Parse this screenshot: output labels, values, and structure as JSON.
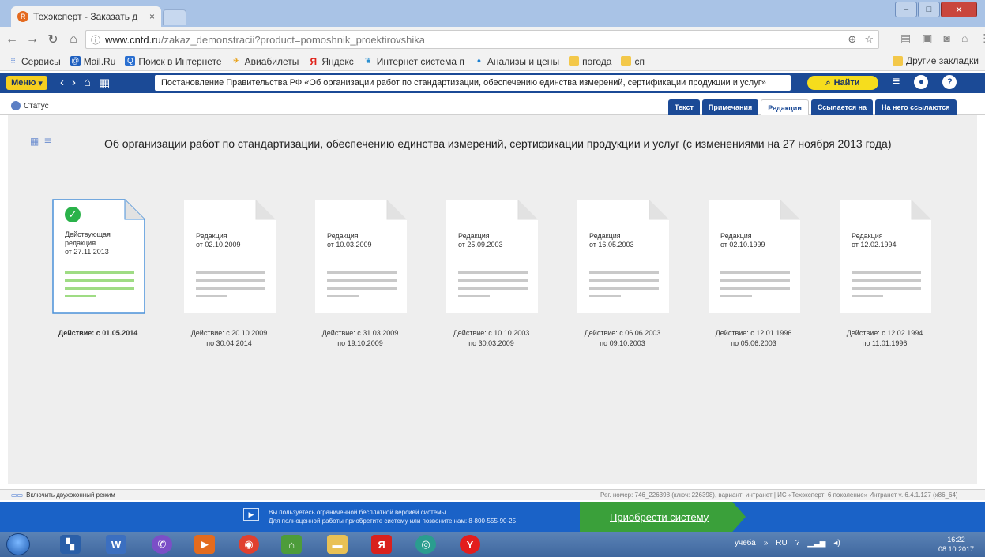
{
  "browser": {
    "tab_title": "Техэксперт - Заказать д",
    "tab_close": "×",
    "url_host": "www.cntd.ru",
    "url_path": "/zakaz_demonstracii?product=pomoshnik_proektirovshika",
    "bookmarks": [
      {
        "label": "Сервисы",
        "icon": "apps-grid-icon"
      },
      {
        "label": "Mail.Ru",
        "icon": "mailru-icon"
      },
      {
        "label": "Поиск в Интернете",
        "icon": "search-icon"
      },
      {
        "label": "Авиабилеты",
        "icon": "plane-icon"
      },
      {
        "label": "Яндекс",
        "icon": "yandex-icon"
      },
      {
        "label": "Интернет система п",
        "icon": "map-pin-icon"
      },
      {
        "label": "Анализы и цены",
        "icon": "drop-icon"
      },
      {
        "label": "погода",
        "icon": "folder-icon"
      },
      {
        "label": "сп",
        "icon": "folder-icon"
      }
    ],
    "other_bookmarks": "Другие закладки"
  },
  "app": {
    "menu_label": "Меню",
    "doc_title": "Постановление Правительства РФ «Об организации работ по стандартизации, обеспечению единства измерений, сертификации продукции и услуг»",
    "find_label": "Найти",
    "status_label": "Статус",
    "tabs": [
      {
        "label": "Текст",
        "active": false
      },
      {
        "label": "Примечания",
        "active": false
      },
      {
        "label": "Редакции",
        "active": true
      },
      {
        "label": "Ссылается на",
        "active": false
      },
      {
        "label": "На него ссылаются",
        "active": false
      }
    ]
  },
  "main": {
    "title": "Об организации работ по стандартизации, обеспечению единства измерений, сертификации продукции и услуг (с изменениями на 27 ноября 2013 года)",
    "editions": [
      {
        "label_lines": [
          "Действующая",
          "редакция",
          "от 27.11.2013"
        ],
        "caption1": "Действие: с 01.05.2014",
        "caption2": "",
        "active": true
      },
      {
        "label_lines": [
          "Редакция",
          "от 02.10.2009"
        ],
        "caption1": "Действие: с 20.10.2009",
        "caption2": "по 30.04.2014",
        "active": false
      },
      {
        "label_lines": [
          "Редакция",
          "от 10.03.2009"
        ],
        "caption1": "Действие: с 31.03.2009",
        "caption2": "по 19.10.2009",
        "active": false
      },
      {
        "label_lines": [
          "Редакция",
          "от 25.09.2003"
        ],
        "caption1": "Действие: с 10.10.2003",
        "caption2": "по 30.03.2009",
        "active": false
      },
      {
        "label_lines": [
          "Редакция",
          "от 16.05.2003"
        ],
        "caption1": "Действие: с 06.06.2003",
        "caption2": "по 09.10.2003",
        "active": false
      },
      {
        "label_lines": [
          "Редакция",
          "от 02.10.1999"
        ],
        "caption1": "Действие: с 12.01.1996",
        "caption2": "по 05.06.2003",
        "active": false
      },
      {
        "label_lines": [
          "Редакция",
          "от 12.02.1994"
        ],
        "caption1": "Действие: с 12.02.1994",
        "caption2": "по 11.01.1996",
        "active": false
      }
    ]
  },
  "footer": {
    "dual_mode": "Включить двухоконный режим",
    "reg_info": "Рег. номер: 746_226398 (ключ: 226398), вариант: интранет  |  ИС «Техэксперт: 6 поколение» Интранет v. 6.4.1.127 (x86_64)"
  },
  "promo": {
    "line1": "Вы пользуетесь ограниченной бесплатной версией системы.",
    "line2": "Для полноценной работы приобретите систему или позвоните нам: 8-800-555-90-25",
    "buy_label": "Приобрести систему"
  },
  "taskbar": {
    "tray_text": "учеба",
    "lang": "RU",
    "time": "16:22",
    "date": "08.10.2017"
  },
  "colors": {
    "toolbar_blue": "#1b4a96",
    "accent_yellow": "#f6dd1d",
    "active_green": "#2ab24a",
    "promo_blue": "#1a62c7",
    "buy_green": "#3aa03a"
  }
}
